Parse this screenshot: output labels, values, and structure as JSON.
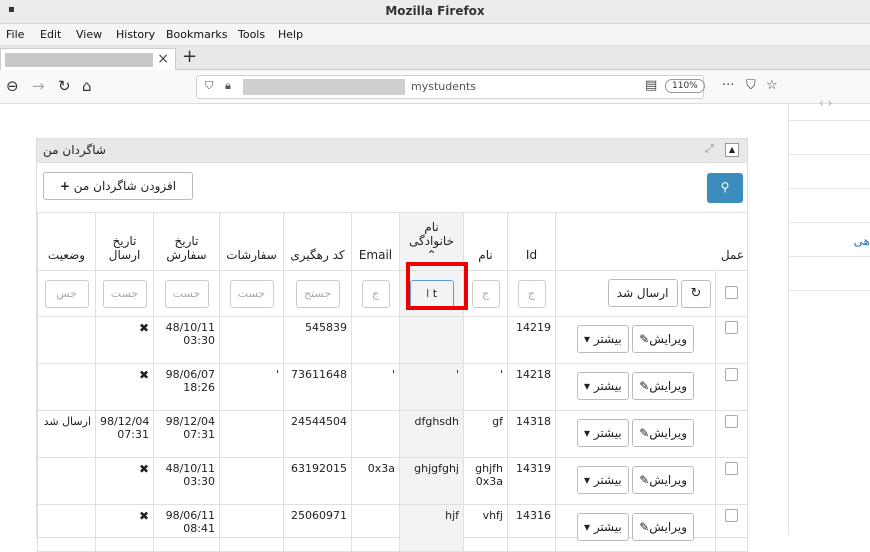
{
  "browser": {
    "title": "Mozilla Firefox",
    "menu": [
      "File",
      "Edit",
      "View",
      "History",
      "Bookmarks",
      "Tools",
      "Help"
    ],
    "url_suffix": "mystudents",
    "zoom": "110%"
  },
  "side": {
    "partial_text": "هی"
  },
  "panel": {
    "title": "شاگردان من",
    "add_button": "افزودن شاگردان من",
    "columns": {
      "action": "عمل",
      "id": "Id",
      "first_name": "نام",
      "last_name": "نام خانوادگی",
      "email": "Email",
      "tracking": "کد رهگیری",
      "orders": "سفارشات",
      "order_date": "تاریخ سفارش",
      "send_date": "تاریخ ارسال",
      "status": "وضعیت"
    },
    "filter": {
      "sent_button": "ارسال شد",
      "ph_short": "ج",
      "ph_tracking": "جستج",
      "ph_search": "جست",
      "ph_status": "جس",
      "last_name_value": "t"
    },
    "edit_label": "ویرایش",
    "more_label": "بیشتر",
    "rows": [
      {
        "id": "14219",
        "first": "",
        "last": "",
        "email": "",
        "tracking": "545839",
        "orders": "",
        "order_date": "48/10/11 03:30",
        "send_date": "✖",
        "status": ""
      },
      {
        "id": "14218",
        "first": "'",
        "last": "'",
        "email": "'",
        "tracking": "73611648",
        "orders": "'",
        "order_date": "98/06/07 18:26",
        "send_date": "✖",
        "status": ""
      },
      {
        "id": "14318",
        "first": "gf",
        "last": "dfghsdh",
        "email": "",
        "tracking": "24544504",
        "orders": "",
        "order_date": "98/12/04 07:31",
        "send_date": "98/12/04 07:31",
        "status": "ارسال شد"
      },
      {
        "id": "14319",
        "first": "ghjfh 0x3a",
        "last": "ghjgfghj",
        "email": "0x3a",
        "tracking": "63192015",
        "orders": "",
        "order_date": "48/10/11 03:30",
        "send_date": "✖",
        "status": ""
      },
      {
        "id": "14316",
        "first": "vhfj",
        "last": "hjf",
        "email": "",
        "tracking": "25060971",
        "orders": "",
        "order_date": "98/06/11 08:41",
        "send_date": "✖",
        "status": ""
      }
    ]
  }
}
